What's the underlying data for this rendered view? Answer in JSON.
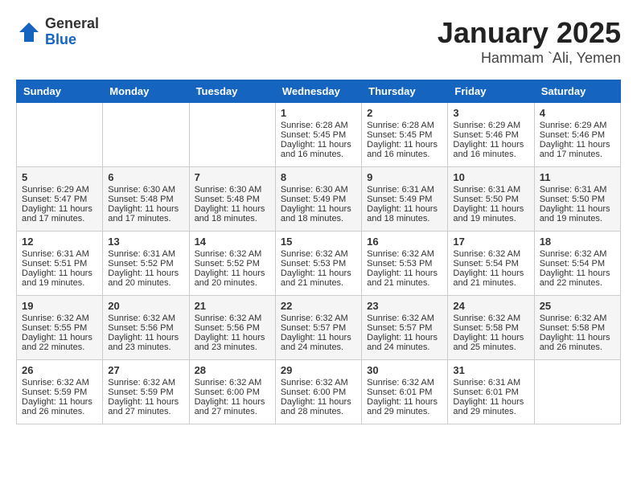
{
  "logo": {
    "general": "General",
    "blue": "Blue"
  },
  "title": "January 2025",
  "subtitle": "Hammam `Ali, Yemen",
  "days_of_week": [
    "Sunday",
    "Monday",
    "Tuesday",
    "Wednesday",
    "Thursday",
    "Friday",
    "Saturday"
  ],
  "weeks": [
    [
      {
        "day": "",
        "info": ""
      },
      {
        "day": "",
        "info": ""
      },
      {
        "day": "",
        "info": ""
      },
      {
        "day": "1",
        "info": "Sunrise: 6:28 AM\nSunset: 5:45 PM\nDaylight: 11 hours and 16 minutes."
      },
      {
        "day": "2",
        "info": "Sunrise: 6:28 AM\nSunset: 5:45 PM\nDaylight: 11 hours and 16 minutes."
      },
      {
        "day": "3",
        "info": "Sunrise: 6:29 AM\nSunset: 5:46 PM\nDaylight: 11 hours and 16 minutes."
      },
      {
        "day": "4",
        "info": "Sunrise: 6:29 AM\nSunset: 5:46 PM\nDaylight: 11 hours and 17 minutes."
      }
    ],
    [
      {
        "day": "5",
        "info": "Sunrise: 6:29 AM\nSunset: 5:47 PM\nDaylight: 11 hours and 17 minutes."
      },
      {
        "day": "6",
        "info": "Sunrise: 6:30 AM\nSunset: 5:48 PM\nDaylight: 11 hours and 17 minutes."
      },
      {
        "day": "7",
        "info": "Sunrise: 6:30 AM\nSunset: 5:48 PM\nDaylight: 11 hours and 18 minutes."
      },
      {
        "day": "8",
        "info": "Sunrise: 6:30 AM\nSunset: 5:49 PM\nDaylight: 11 hours and 18 minutes."
      },
      {
        "day": "9",
        "info": "Sunrise: 6:31 AM\nSunset: 5:49 PM\nDaylight: 11 hours and 18 minutes."
      },
      {
        "day": "10",
        "info": "Sunrise: 6:31 AM\nSunset: 5:50 PM\nDaylight: 11 hours and 19 minutes."
      },
      {
        "day": "11",
        "info": "Sunrise: 6:31 AM\nSunset: 5:50 PM\nDaylight: 11 hours and 19 minutes."
      }
    ],
    [
      {
        "day": "12",
        "info": "Sunrise: 6:31 AM\nSunset: 5:51 PM\nDaylight: 11 hours and 19 minutes."
      },
      {
        "day": "13",
        "info": "Sunrise: 6:31 AM\nSunset: 5:52 PM\nDaylight: 11 hours and 20 minutes."
      },
      {
        "day": "14",
        "info": "Sunrise: 6:32 AM\nSunset: 5:52 PM\nDaylight: 11 hours and 20 minutes."
      },
      {
        "day": "15",
        "info": "Sunrise: 6:32 AM\nSunset: 5:53 PM\nDaylight: 11 hours and 21 minutes."
      },
      {
        "day": "16",
        "info": "Sunrise: 6:32 AM\nSunset: 5:53 PM\nDaylight: 11 hours and 21 minutes."
      },
      {
        "day": "17",
        "info": "Sunrise: 6:32 AM\nSunset: 5:54 PM\nDaylight: 11 hours and 21 minutes."
      },
      {
        "day": "18",
        "info": "Sunrise: 6:32 AM\nSunset: 5:54 PM\nDaylight: 11 hours and 22 minutes."
      }
    ],
    [
      {
        "day": "19",
        "info": "Sunrise: 6:32 AM\nSunset: 5:55 PM\nDaylight: 11 hours and 22 minutes."
      },
      {
        "day": "20",
        "info": "Sunrise: 6:32 AM\nSunset: 5:56 PM\nDaylight: 11 hours and 23 minutes."
      },
      {
        "day": "21",
        "info": "Sunrise: 6:32 AM\nSunset: 5:56 PM\nDaylight: 11 hours and 23 minutes."
      },
      {
        "day": "22",
        "info": "Sunrise: 6:32 AM\nSunset: 5:57 PM\nDaylight: 11 hours and 24 minutes."
      },
      {
        "day": "23",
        "info": "Sunrise: 6:32 AM\nSunset: 5:57 PM\nDaylight: 11 hours and 24 minutes."
      },
      {
        "day": "24",
        "info": "Sunrise: 6:32 AM\nSunset: 5:58 PM\nDaylight: 11 hours and 25 minutes."
      },
      {
        "day": "25",
        "info": "Sunrise: 6:32 AM\nSunset: 5:58 PM\nDaylight: 11 hours and 26 minutes."
      }
    ],
    [
      {
        "day": "26",
        "info": "Sunrise: 6:32 AM\nSunset: 5:59 PM\nDaylight: 11 hours and 26 minutes."
      },
      {
        "day": "27",
        "info": "Sunrise: 6:32 AM\nSunset: 5:59 PM\nDaylight: 11 hours and 27 minutes."
      },
      {
        "day": "28",
        "info": "Sunrise: 6:32 AM\nSunset: 6:00 PM\nDaylight: 11 hours and 27 minutes."
      },
      {
        "day": "29",
        "info": "Sunrise: 6:32 AM\nSunset: 6:00 PM\nDaylight: 11 hours and 28 minutes."
      },
      {
        "day": "30",
        "info": "Sunrise: 6:32 AM\nSunset: 6:01 PM\nDaylight: 11 hours and 29 minutes."
      },
      {
        "day": "31",
        "info": "Sunrise: 6:31 AM\nSunset: 6:01 PM\nDaylight: 11 hours and 29 minutes."
      },
      {
        "day": "",
        "info": ""
      }
    ]
  ]
}
